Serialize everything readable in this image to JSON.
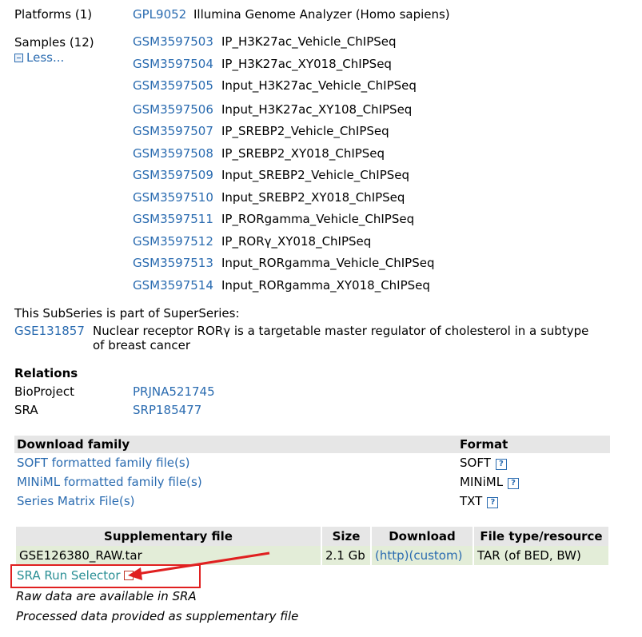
{
  "platforms": {
    "label": "Platforms (1)",
    "accession": "GPL9052",
    "title": "Illumina Genome Analyzer (Homo sapiens)"
  },
  "samples": {
    "label": "Samples (12)",
    "less_label": "Less...",
    "items": [
      {
        "accession": "GSM3597503",
        "title": "IP_H3K27ac_Vehicle_ChIPSeq"
      },
      {
        "accession": "GSM3597504",
        "title": "IP_H3K27ac_XY018_ChIPSeq"
      },
      {
        "accession": "GSM3597505",
        "title": "Input_H3K27ac_Vehicle_ChIPSeq"
      },
      {
        "accession": "GSM3597506",
        "title": "Input_H3K27ac_XY108_ChIPSeq"
      },
      {
        "accession": "GSM3597507",
        "title": "IP_SREBP2_Vehicle_ChIPSeq"
      },
      {
        "accession": "GSM3597508",
        "title": "IP_SREBP2_XY018_ChIPSeq"
      },
      {
        "accession": "GSM3597509",
        "title": "Input_SREBP2_Vehicle_ChIPSeq"
      },
      {
        "accession": "GSM3597510",
        "title": "Input_SREBP2_XY018_ChIPSeq"
      },
      {
        "accession": "GSM3597511",
        "title": "IP_RORgamma_Vehicle_ChIPSeq"
      },
      {
        "accession": "GSM3597512",
        "title": "IP_RORγ_XY018_ChIPSeq"
      },
      {
        "accession": "GSM3597513",
        "title": "Input_RORgamma_Vehicle_ChIPSeq"
      },
      {
        "accession": "GSM3597514",
        "title": "Input_RORgamma_XY018_ChIPSeq"
      }
    ]
  },
  "superseries": {
    "intro": "This SubSeries is part of SuperSeries:",
    "accession": "GSE131857",
    "title_line1": "Nuclear receptor RORγ is a targetable master regulator of cholesterol in a subtype",
    "title_line2": "of breast cancer"
  },
  "relations": {
    "heading": "Relations",
    "bioproject_label": "BioProject",
    "bioproject_value": "PRJNA521745",
    "sra_label": "SRA",
    "sra_value": "SRP185477"
  },
  "download_family": {
    "header_left": "Download family",
    "header_right": "Format",
    "rows": [
      {
        "link": "SOFT formatted family file(s)",
        "format": "SOFT"
      },
      {
        "link": "MINiML formatted family file(s)",
        "format": "MINiML"
      },
      {
        "link": "Series Matrix File(s)",
        "format": "TXT"
      }
    ]
  },
  "supplementary": {
    "headers": [
      "Supplementary file",
      "Size",
      "Download",
      "File type/resource"
    ],
    "row": {
      "file": "GSE126380_RAW.tar",
      "size": "2.1 Gb",
      "http": "(http)",
      "custom": "(custom)",
      "type": "TAR (of BED, BW)"
    },
    "sra_run_selector": "SRA Run Selector",
    "note1": "Raw data are available in SRA",
    "note2": "Processed data provided as supplementary file"
  },
  "help_glyph": "?",
  "annotation_color": "#e02020"
}
